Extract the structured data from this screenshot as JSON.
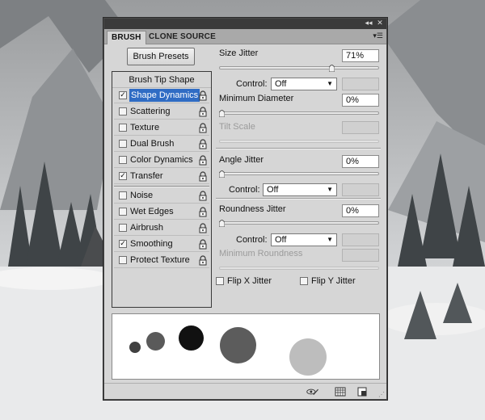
{
  "panel": {
    "tabs": {
      "active": "BRUSH",
      "inactive": "CLONE SOURCE"
    },
    "titlebar_icons": [
      "collapse-icon",
      "close-icon"
    ],
    "menu_icon": "panel-menu-icon"
  },
  "left": {
    "presets_button": "Brush Presets",
    "tip_shape": "Brush Tip Shape",
    "options": [
      {
        "label": "Shape Dynamics",
        "checked": true,
        "selected": true
      },
      {
        "label": "Scattering",
        "checked": false
      },
      {
        "label": "Texture",
        "checked": false
      },
      {
        "label": "Dual Brush",
        "checked": false
      },
      {
        "label": "Color Dynamics",
        "checked": false
      },
      {
        "label": "Transfer",
        "checked": true
      },
      {
        "label": "Noise",
        "checked": false
      },
      {
        "label": "Wet Edges",
        "checked": false
      },
      {
        "label": "Airbrush",
        "checked": false
      },
      {
        "label": "Smoothing",
        "checked": true
      },
      {
        "label": "Protect Texture",
        "checked": false
      }
    ],
    "check_mark": "✓"
  },
  "right": {
    "size_jitter": {
      "label": "Size Jitter",
      "value": "71%",
      "level": 0.71
    },
    "control1": {
      "label": "Control:",
      "value": "Off"
    },
    "min_diameter": {
      "label": "Minimum Diameter",
      "value": "0%",
      "level": 0
    },
    "tilt_scale": {
      "label": "Tilt Scale"
    },
    "angle_jitter": {
      "label": "Angle Jitter",
      "value": "0%",
      "level": 0
    },
    "control2": {
      "label": "Control:",
      "value": "Off"
    },
    "roundness_jitter": {
      "label": "Roundness Jitter",
      "value": "0%",
      "level": 0
    },
    "control3": {
      "label": "Control:",
      "value": "Off"
    },
    "min_roundness": {
      "label": "Minimum Roundness"
    },
    "flip_x": {
      "label": "Flip X Jitter",
      "checked": false
    },
    "flip_y": {
      "label": "Flip Y Jitter",
      "checked": false
    }
  },
  "bottom_icons": [
    "toggle-live-tip-icon",
    "grid-icon",
    "create-new-preset-icon"
  ],
  "colors": {
    "panel": "#d6d6d6",
    "selection": "#2f6cc4",
    "titlebar": "#3b3b3b"
  }
}
